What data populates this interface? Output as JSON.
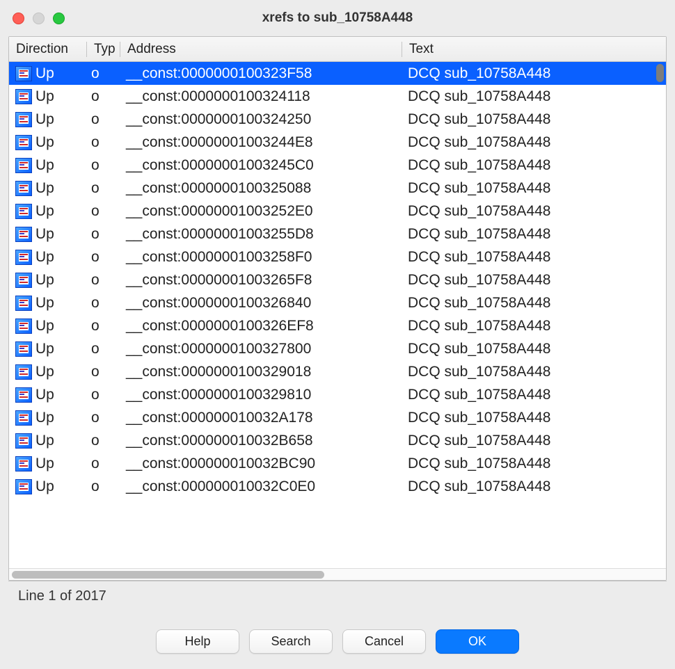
{
  "window": {
    "title": "xrefs to sub_10758A448"
  },
  "columns": {
    "direction": "Direction",
    "type": "Typ",
    "address": "Address",
    "text": "Text"
  },
  "rows": [
    {
      "direction": "Up",
      "type": "o",
      "address": "__const:0000000100323F58",
      "text": "DCQ sub_10758A448",
      "selected": true
    },
    {
      "direction": "Up",
      "type": "o",
      "address": "__const:0000000100324118",
      "text": "DCQ sub_10758A448",
      "selected": false
    },
    {
      "direction": "Up",
      "type": "o",
      "address": "__const:0000000100324250",
      "text": "DCQ sub_10758A448",
      "selected": false
    },
    {
      "direction": "Up",
      "type": "o",
      "address": "__const:00000001003244E8",
      "text": "DCQ sub_10758A448",
      "selected": false
    },
    {
      "direction": "Up",
      "type": "o",
      "address": "__const:00000001003245C0",
      "text": "DCQ sub_10758A448",
      "selected": false
    },
    {
      "direction": "Up",
      "type": "o",
      "address": "__const:0000000100325088",
      "text": "DCQ sub_10758A448",
      "selected": false
    },
    {
      "direction": "Up",
      "type": "o",
      "address": "__const:00000001003252E0",
      "text": "DCQ sub_10758A448",
      "selected": false
    },
    {
      "direction": "Up",
      "type": "o",
      "address": "__const:00000001003255D8",
      "text": "DCQ sub_10758A448",
      "selected": false
    },
    {
      "direction": "Up",
      "type": "o",
      "address": "__const:00000001003258F0",
      "text": "DCQ sub_10758A448",
      "selected": false
    },
    {
      "direction": "Up",
      "type": "o",
      "address": "__const:00000001003265F8",
      "text": "DCQ sub_10758A448",
      "selected": false
    },
    {
      "direction": "Up",
      "type": "o",
      "address": "__const:0000000100326840",
      "text": "DCQ sub_10758A448",
      "selected": false
    },
    {
      "direction": "Up",
      "type": "o",
      "address": "__const:0000000100326EF8",
      "text": "DCQ sub_10758A448",
      "selected": false
    },
    {
      "direction": "Up",
      "type": "o",
      "address": "__const:0000000100327800",
      "text": "DCQ sub_10758A448",
      "selected": false
    },
    {
      "direction": "Up",
      "type": "o",
      "address": "__const:0000000100329018",
      "text": "DCQ sub_10758A448",
      "selected": false
    },
    {
      "direction": "Up",
      "type": "o",
      "address": "__const:0000000100329810",
      "text": "DCQ sub_10758A448",
      "selected": false
    },
    {
      "direction": "Up",
      "type": "o",
      "address": "__const:000000010032A178",
      "text": "DCQ sub_10758A448",
      "selected": false
    },
    {
      "direction": "Up",
      "type": "o",
      "address": "__const:000000010032B658",
      "text": "DCQ sub_10758A448",
      "selected": false
    },
    {
      "direction": "Up",
      "type": "o",
      "address": "__const:000000010032BC90",
      "text": "DCQ sub_10758A448",
      "selected": false
    },
    {
      "direction": "Up",
      "type": "o",
      "address": "__const:000000010032C0E0",
      "text": "DCQ sub_10758A448",
      "selected": false
    }
  ],
  "status": "Line 1 of 2017",
  "buttons": {
    "help": "Help",
    "search": "Search",
    "cancel": "Cancel",
    "ok": "OK"
  }
}
